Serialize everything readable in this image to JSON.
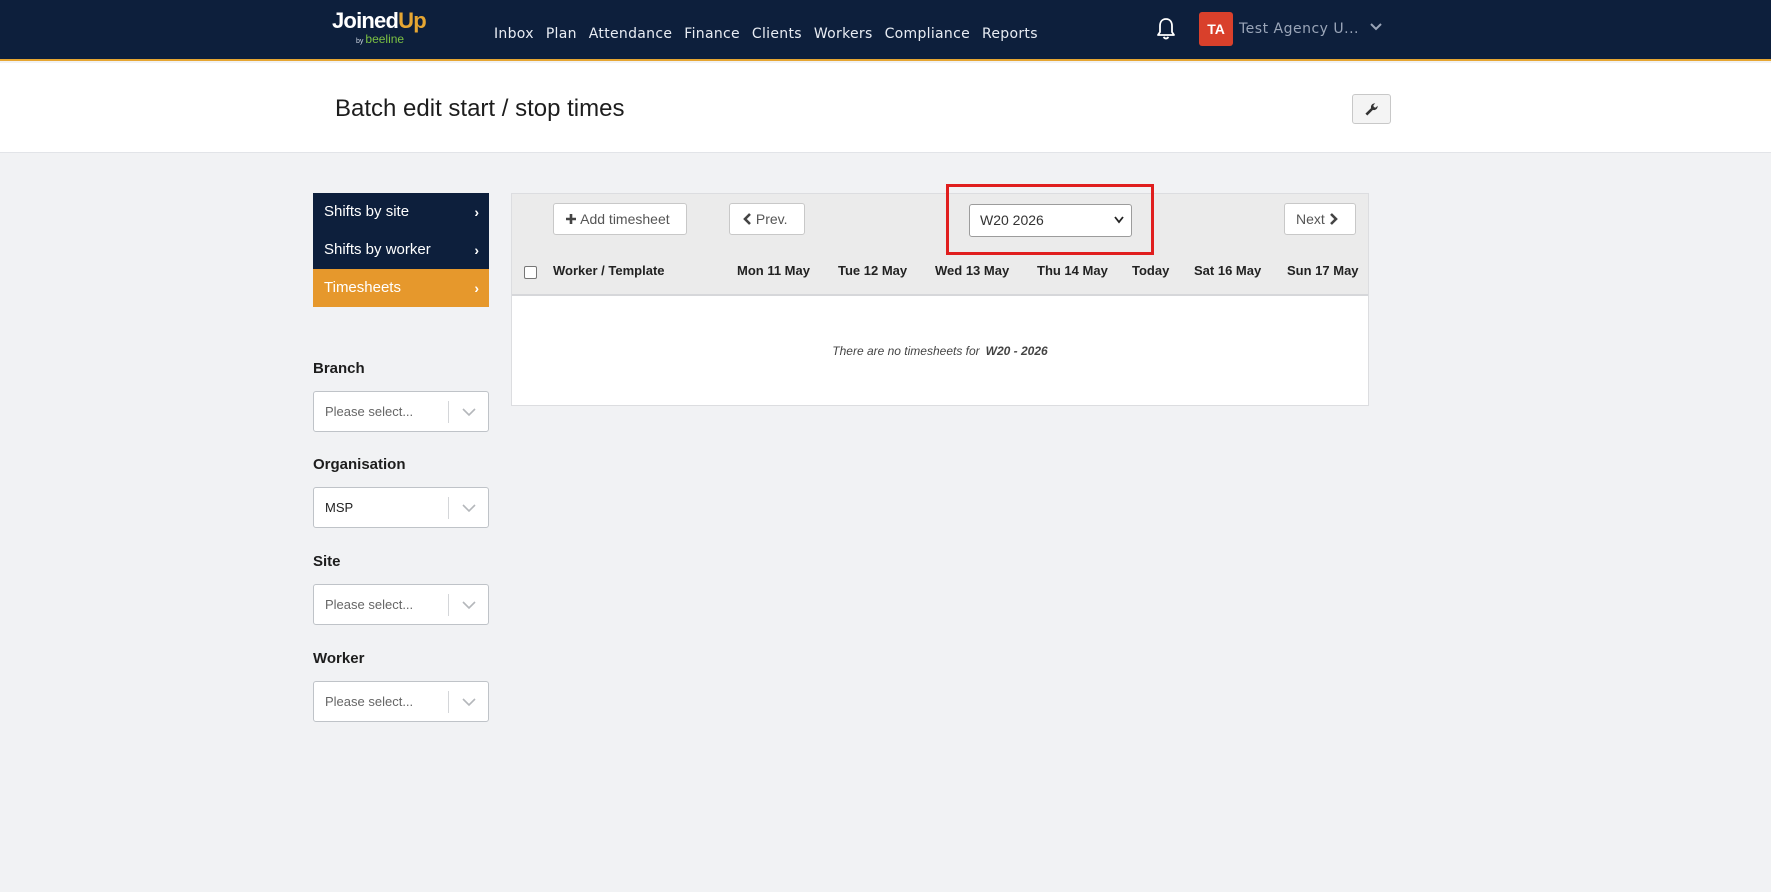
{
  "brand": {
    "logo_primary": "Joined",
    "logo_accent": "Up",
    "logo_by": "by",
    "logo_sub": "beeline"
  },
  "nav": {
    "items": [
      "Inbox",
      "Plan",
      "Attendance",
      "Finance",
      "Clients",
      "Workers",
      "Compliance",
      "Reports"
    ]
  },
  "user": {
    "initials": "TA",
    "name": "Test Agency U..."
  },
  "page": {
    "title": "Batch edit start / stop times"
  },
  "sidebar": {
    "items": [
      {
        "label": "Shifts by site",
        "chevron": "›"
      },
      {
        "label": "Shifts by worker",
        "chevron": "›"
      },
      {
        "label": "Timesheets",
        "chevron": "›",
        "active": true
      }
    ]
  },
  "filters": {
    "branch": {
      "label": "Branch",
      "value": "Please select..."
    },
    "organisation": {
      "label": "Organisation",
      "value": "MSP"
    },
    "site": {
      "label": "Site",
      "value": "Please select..."
    },
    "worker": {
      "label": "Worker",
      "value": "Please select..."
    }
  },
  "toolbar": {
    "add_label": "Add timesheet",
    "prev_label": "Prev.",
    "next_label": "Next",
    "week_value": "W20 2026"
  },
  "table": {
    "columns": [
      "Worker / Template",
      "Mon 11 May",
      "Tue 12 May",
      "Wed 13 May",
      "Thu 14 May",
      "Today",
      "Sat 16 May",
      "Sun 17 May"
    ],
    "empty_prefix": "There are no timesheets for",
    "empty_week": "W20 - 2026"
  },
  "colors": {
    "navy": "#0d1f3c",
    "accent": "#e6982c",
    "avatar": "#d9402b",
    "highlight": "#e01e1e"
  }
}
